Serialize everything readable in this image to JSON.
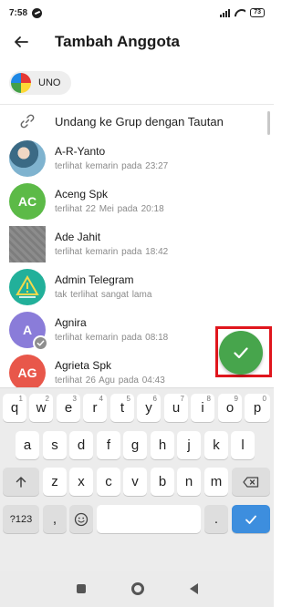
{
  "status_bar": {
    "time": "7:58",
    "battery": "73"
  },
  "app_bar": {
    "title": "Tambah Anggota"
  },
  "selected_chip": {
    "label": "UNO"
  },
  "invite": {
    "label": "Undang ke Grup dengan Tautan"
  },
  "contacts": [
    {
      "name": "A-R-Yanto",
      "status": "terlihat kemarin pada  23:27",
      "avatar_type": "photo",
      "avatar_color": "#5a8fb0"
    },
    {
      "name": "Aceng Spk",
      "status": "terlihat 22 Mei pada 20:18",
      "initials": "AC",
      "avatar_type": "initials",
      "avatar_color": "#5cba47"
    },
    {
      "name": "Ade Jahit",
      "status": "terlihat kemarin pada  18:42",
      "avatar_type": "photo-square",
      "avatar_color": "#8a8a8a"
    },
    {
      "name": "Admin Telegram",
      "status": "tak terlihat sangat lama",
      "avatar_type": "logo",
      "avatar_color": "#22b09a"
    },
    {
      "name": "Agnira",
      "status": "terlihat kemarin pada  08:18",
      "initials": "A",
      "avatar_type": "initials-checked",
      "avatar_color": "#8a7cd9"
    },
    {
      "name": "Agrieta Spk",
      "status": "terlihat 26 Agu pada 04:43",
      "initials": "AG",
      "avatar_type": "initials",
      "avatar_color": "#e8574a"
    }
  ],
  "keyboard": {
    "row1": [
      {
        "key": "q",
        "hint": "1"
      },
      {
        "key": "w",
        "hint": "2"
      },
      {
        "key": "e",
        "hint": "3"
      },
      {
        "key": "r",
        "hint": "4"
      },
      {
        "key": "t",
        "hint": "5"
      },
      {
        "key": "y",
        "hint": "6"
      },
      {
        "key": "u",
        "hint": "7"
      },
      {
        "key": "i",
        "hint": "8"
      },
      {
        "key": "o",
        "hint": "9"
      },
      {
        "key": "p",
        "hint": "0"
      }
    ],
    "row2": [
      "a",
      "s",
      "d",
      "f",
      "g",
      "h",
      "j",
      "k",
      "l"
    ],
    "row3": [
      "z",
      "x",
      "c",
      "v",
      "b",
      "n",
      "m"
    ],
    "symbols_label": "?123",
    "comma": ",",
    "period": "."
  },
  "colors": {
    "accent_green": "#47a54c",
    "highlight_red": "#e0161d",
    "enter_blue": "#3d8ede"
  }
}
